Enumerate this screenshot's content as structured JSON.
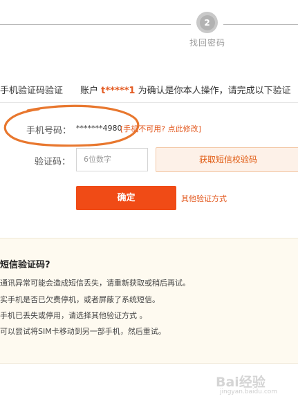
{
  "progress": {
    "step_number": "2",
    "step_label": "找回密码"
  },
  "header": {
    "method_title": "手机验证码验证",
    "account_prefix": "账户",
    "account_name": "t*****1",
    "account_suffix": "为确认是你本人操作，请完成以下验证"
  },
  "form": {
    "phone_label": "手机号码：",
    "phone_value": "*******4980",
    "phone_change_link": "[手机不可用? 点此修改]",
    "code_label": "验证码：",
    "code_placeholder": "6位数字",
    "get_code_button": "获取短信校验码",
    "confirm_button": "确定",
    "other_methods_link": "其他验证方式"
  },
  "help": {
    "title": "短信验证码?",
    "items": [
      "通讯异常可能会造成短信丢失，请重新获取或稍后再试。",
      "实手机是否已欠费停机，或者屏蔽了系统短信。",
      "手机已丢失或停用，请选择其他验证方式 。",
      "可以尝试将SIM卡移动到另一部手机，然后重试。"
    ]
  },
  "watermark": {
    "text": "Bai经验",
    "sub": "jingyan.baidu.com"
  },
  "colors": {
    "accent": "#f04b16",
    "link": "#e35a21",
    "annotation": "#e8772e",
    "help_bg": "#fefaf0"
  }
}
